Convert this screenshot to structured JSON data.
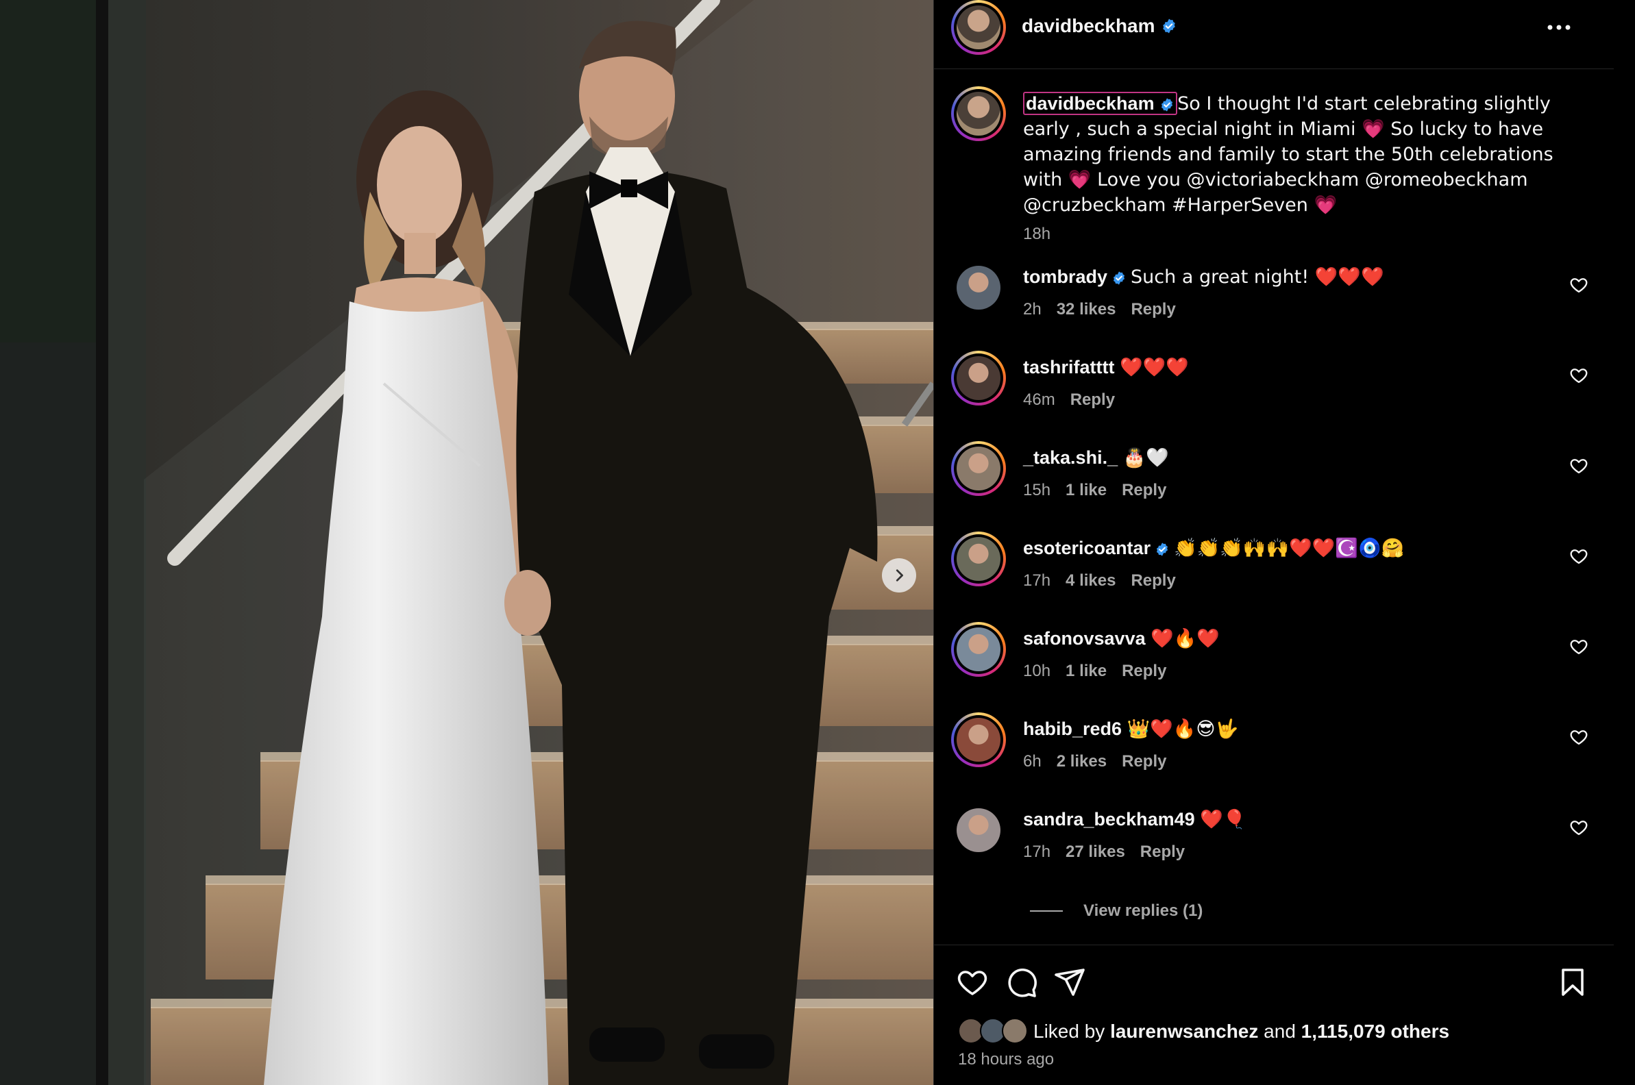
{
  "post": {
    "author": "davidbeckham",
    "caption": {
      "username": "davidbeckham",
      "text": "So I thought I'd start celebrating slightly early , such a special night in Miami 💗 So lucky to have amazing friends and family to start the 50th celebrations with 💗 Love you @victoriabeckham @romeobeckham @cruzbeckham #HarperSeven 💗",
      "time": "18h"
    },
    "comments": [
      {
        "username": "tombrady",
        "verified": true,
        "text": "Such a great night! ❤️❤️❤️",
        "time": "2h",
        "likes": "32 likes",
        "reply": "Reply",
        "avatar_color": "#5a6470"
      },
      {
        "username": "tashrifatttt",
        "verified": false,
        "text": "❤️❤️❤️",
        "time": "46m",
        "likes": "",
        "reply": "Reply",
        "avatar_color": "#4a3a34"
      },
      {
        "username": "_taka.shi._",
        "verified": false,
        "text": "🎂🤍",
        "time": "15h",
        "likes": "1 like",
        "reply": "Reply",
        "avatar_color": "#8a7a6a"
      },
      {
        "username": "esotericoantar",
        "verified": true,
        "text": "👏👏👏🙌🙌❤️❤️☪️🧿🤗",
        "time": "17h",
        "likes": "4 likes",
        "reply": "Reply",
        "avatar_color": "#6a6a5a"
      },
      {
        "username": "safonovsavva",
        "verified": false,
        "text": "❤️🔥❤️",
        "time": "10h",
        "likes": "1 like",
        "reply": "Reply",
        "avatar_color": "#7a8a9a"
      },
      {
        "username": "habib_red6",
        "verified": false,
        "text": "👑❤️🔥😎🤟",
        "time": "6h",
        "likes": "2 likes",
        "reply": "Reply",
        "avatar_color": "#8a4a3a"
      },
      {
        "username": "sandra_beckham49",
        "verified": false,
        "text": "❤️🎈",
        "time": "17h",
        "likes": "27 likes",
        "reply": "Reply",
        "avatar_color": "#9a9090"
      }
    ],
    "view_replies": "View replies (1)",
    "liked_by": {
      "prefix": "Liked by",
      "user": "laurenwsanchez",
      "and": "and",
      "others": "1,115,079 others"
    },
    "posted_ago": "18 hours ago"
  },
  "icons": {
    "verified": "verified-badge-icon",
    "more": "more-options-icon",
    "like": "heart-icon",
    "comment": "comment-bubble-icon",
    "share": "paper-plane-icon",
    "save": "bookmark-icon",
    "next": "chevron-right-icon"
  },
  "colors": {
    "verified": "#3897f0",
    "story_ring_start": "#feda75",
    "story_ring_end": "#962fbf",
    "caption_highlight": "#c13584",
    "muted_text": "#a8a8a8"
  }
}
